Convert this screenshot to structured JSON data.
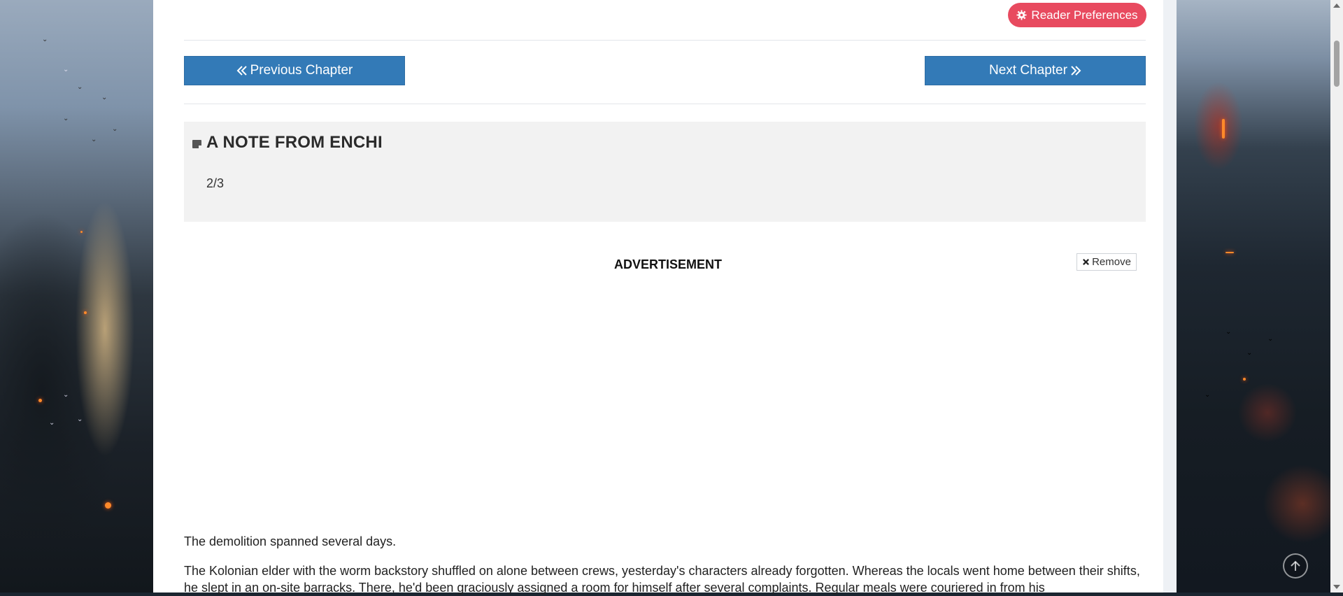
{
  "header": {
    "reader_preferences_label": "Reader Preferences",
    "reader_preferences_icon": "gear-icon"
  },
  "navigation": {
    "previous_label": "Previous Chapter",
    "previous_icon": "double-chevron-left-icon",
    "next_label": "Next Chapter",
    "next_icon": "double-chevron-right-icon"
  },
  "author_note": {
    "title": "A NOTE FROM ENCHI",
    "icon": "note-icon",
    "body": "2/3"
  },
  "advertisement": {
    "label": "ADVERTISEMENT",
    "remove_label": "Remove",
    "remove_icon": "close-icon"
  },
  "chapter": {
    "paragraphs": [
      "The demolition spanned several days.",
      "The Kolonian elder with the worm backstory shuffled on alone between crews, yesterday's characters already forgotten. Whereas the locals went home between their shifts, he slept in an on-site barracks. There, he'd been graciously assigned a room for himself after several complaints. Regular meals were couriered in from his"
    ]
  },
  "colors": {
    "reader_preferences_bg": "#e84a5f",
    "nav_button_bg": "#337ab7",
    "note_bg": "#f2f2f2"
  },
  "scroll_to_top_icon": "arrow-up-circle-icon"
}
